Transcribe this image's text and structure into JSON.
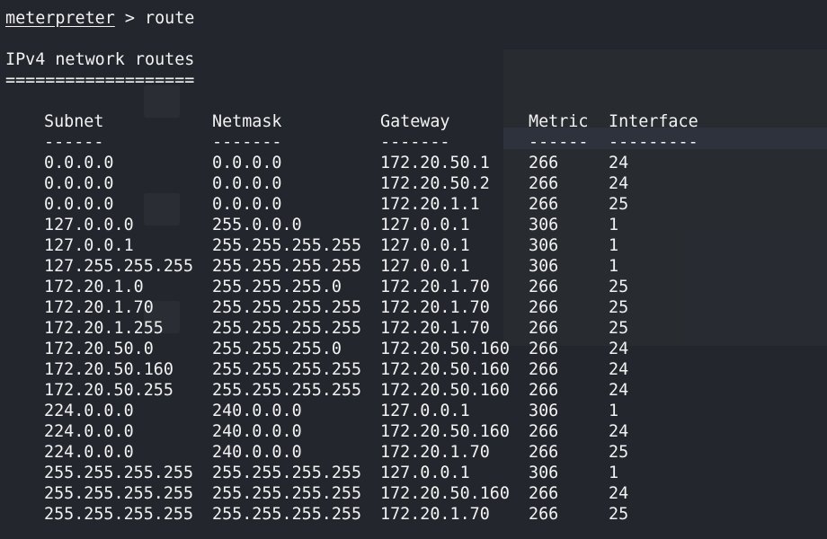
{
  "terminal": {
    "prompt_name": "meterpreter",
    "prompt_sep": " > ",
    "command": "route",
    "section_title": "IPv4 network routes",
    "section_underline": "===================",
    "headers": {
      "subnet": "Subnet",
      "netmask": "Netmask",
      "gateway": "Gateway",
      "metric": "Metric",
      "interface": "Interface"
    },
    "dashes": {
      "subnet": "------",
      "netmask": "-------",
      "gateway": "-------",
      "metric": "------",
      "interface": "---------"
    },
    "routes": [
      {
        "subnet": "0.0.0.0",
        "netmask": "0.0.0.0",
        "gateway": "172.20.50.1",
        "metric": "266",
        "interface": "24"
      },
      {
        "subnet": "0.0.0.0",
        "netmask": "0.0.0.0",
        "gateway": "172.20.50.2",
        "metric": "266",
        "interface": "24"
      },
      {
        "subnet": "0.0.0.0",
        "netmask": "0.0.0.0",
        "gateway": "172.20.1.1",
        "metric": "266",
        "interface": "25"
      },
      {
        "subnet": "127.0.0.0",
        "netmask": "255.0.0.0",
        "gateway": "127.0.0.1",
        "metric": "306",
        "interface": "1"
      },
      {
        "subnet": "127.0.0.1",
        "netmask": "255.255.255.255",
        "gateway": "127.0.0.1",
        "metric": "306",
        "interface": "1"
      },
      {
        "subnet": "127.255.255.255",
        "netmask": "255.255.255.255",
        "gateway": "127.0.0.1",
        "metric": "306",
        "interface": "1"
      },
      {
        "subnet": "172.20.1.0",
        "netmask": "255.255.255.0",
        "gateway": "172.20.1.70",
        "metric": "266",
        "interface": "25"
      },
      {
        "subnet": "172.20.1.70",
        "netmask": "255.255.255.255",
        "gateway": "172.20.1.70",
        "metric": "266",
        "interface": "25"
      },
      {
        "subnet": "172.20.1.255",
        "netmask": "255.255.255.255",
        "gateway": "172.20.1.70",
        "metric": "266",
        "interface": "25"
      },
      {
        "subnet": "172.20.50.0",
        "netmask": "255.255.255.0",
        "gateway": "172.20.50.160",
        "metric": "266",
        "interface": "24"
      },
      {
        "subnet": "172.20.50.160",
        "netmask": "255.255.255.255",
        "gateway": "172.20.50.160",
        "metric": "266",
        "interface": "24"
      },
      {
        "subnet": "172.20.50.255",
        "netmask": "255.255.255.255",
        "gateway": "172.20.50.160",
        "metric": "266",
        "interface": "24"
      },
      {
        "subnet": "224.0.0.0",
        "netmask": "240.0.0.0",
        "gateway": "127.0.0.1",
        "metric": "306",
        "interface": "1"
      },
      {
        "subnet": "224.0.0.0",
        "netmask": "240.0.0.0",
        "gateway": "172.20.50.160",
        "metric": "266",
        "interface": "24"
      },
      {
        "subnet": "224.0.0.0",
        "netmask": "240.0.0.0",
        "gateway": "172.20.1.70",
        "metric": "266",
        "interface": "25"
      },
      {
        "subnet": "255.255.255.255",
        "netmask": "255.255.255.255",
        "gateway": "127.0.0.1",
        "metric": "306",
        "interface": "1"
      },
      {
        "subnet": "255.255.255.255",
        "netmask": "255.255.255.255",
        "gateway": "172.20.50.160",
        "metric": "266",
        "interface": "24"
      },
      {
        "subnet": "255.255.255.255",
        "netmask": "255.255.255.255",
        "gateway": "172.20.1.70",
        "metric": "266",
        "interface": "25"
      }
    ]
  },
  "colors": {
    "background": "#23262c",
    "text": "#f2f2f2"
  }
}
